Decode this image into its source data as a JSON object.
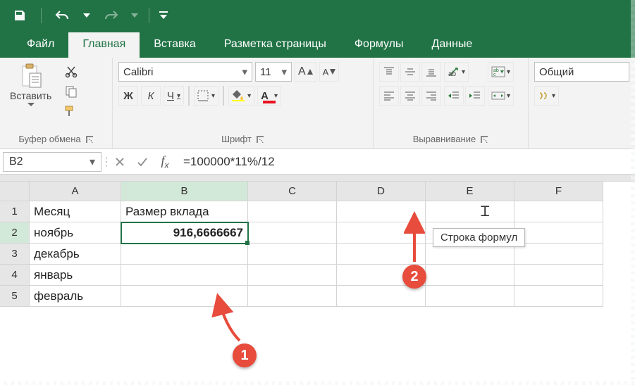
{
  "tabs": {
    "file": "Файл",
    "home": "Главная",
    "insert": "Вставка",
    "layout": "Разметка страницы",
    "formulas": "Формулы",
    "data": "Данные"
  },
  "ribbon": {
    "clipboard": {
      "paste": "Вставить",
      "label": "Буфер обмена"
    },
    "font": {
      "name": "Calibri",
      "size": "11",
      "label": "Шрифт",
      "bold": "Ж",
      "italic": "К",
      "underline": "Ч"
    },
    "alignment": {
      "label": "Выравнивание"
    },
    "number": {
      "format": "Общий"
    }
  },
  "namebox": "B2",
  "formula": "=100000*11%/12",
  "tooltip": "Строка формул",
  "columns": [
    "A",
    "B",
    "C",
    "D",
    "E",
    "F"
  ],
  "rows": [
    {
      "n": "1",
      "A": "Месяц",
      "B": "Размер вклада"
    },
    {
      "n": "2",
      "A": "ноябрь",
      "B": "916,6666667"
    },
    {
      "n": "3",
      "A": "декабрь",
      "B": ""
    },
    {
      "n": "4",
      "A": "январь",
      "B": ""
    },
    {
      "n": "5",
      "A": "февраль",
      "B": ""
    }
  ],
  "badges": {
    "b1": "1",
    "b2": "2"
  },
  "active_cell": "B2"
}
